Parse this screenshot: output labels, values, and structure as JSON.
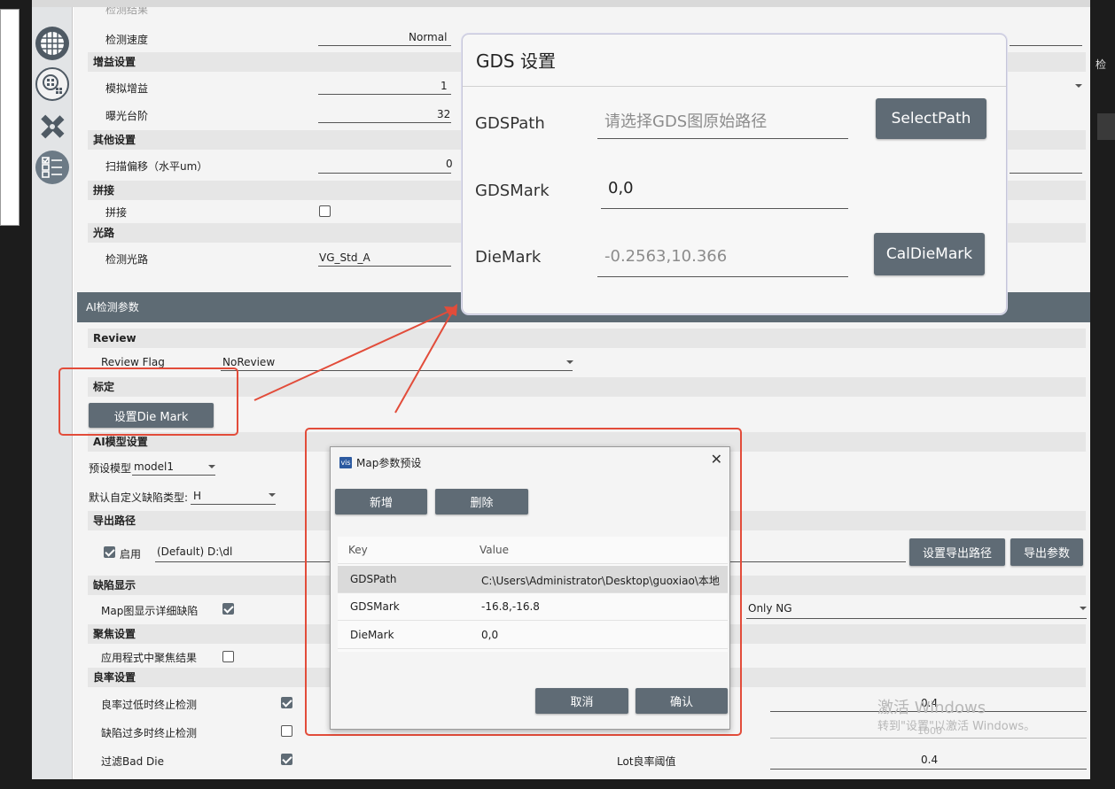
{
  "frame": {
    "right_char": "检"
  },
  "sidebar": {
    "icons": [
      "grid-icon",
      "map-grid-icon",
      "tools-icon",
      "checklist-icon"
    ]
  },
  "upper": {
    "partial_top_label": "检测结果",
    "speed_label": "检测速度",
    "speed_value": "Normal",
    "gain_section": "增益设置",
    "analog_gain_label": "模拟增益",
    "analog_gain_value": "1",
    "exposure_label": "曝光台阶",
    "exposure_value": "32",
    "other_section": "其他设置",
    "scan_offset_label": "扫描偏移（水平um）",
    "scan_offset_value": "0",
    "stitch_section": "拼接",
    "stitch_label": "拼接",
    "optics_section": "光路",
    "optics_label": "检测光路",
    "optics_value": "VG_Std_A"
  },
  "ai": {
    "header": "AI检测参数",
    "review_section": "Review",
    "review_flag_label": "Review Flag",
    "review_flag_value": "NoReview",
    "calib_section": "标定",
    "set_die_mark_button": "设置Die Mark",
    "model_section": "AI模型设置",
    "preset_model_label": "预设模型",
    "preset_model_value": "model1",
    "defect_type_label": "默认自定义缺陷类型:",
    "defect_type_value": "H",
    "export_section": "导出路径",
    "enable_label": "启用",
    "export_path_value": "(Default) D:\\dl",
    "set_export_path_button": "设置导出路径",
    "export_params_button": "导出参数",
    "defect_display_section": "缺陷显示",
    "map_detail_label": "Map图显示详细缺陷",
    "only_ng_value": "Only NG",
    "focus_section": "聚焦设置",
    "apply_focus_label": "应用程式中聚焦结果",
    "yield_section": "良率设置",
    "yield_low_stop_label": "良率过低时终止检测",
    "defect_many_stop_label": "缺陷过多时终止检测",
    "filter_bad_die_label": "过滤Bad Die",
    "lot_yield_label": "Lot良率阈值",
    "lot_yield_value": "0.4",
    "wafer_threshold_value": "0.4",
    "defect_count_value": "1000"
  },
  "gds_panel": {
    "title": "GDS 设置",
    "path_label": "GDSPath",
    "path_placeholder": "请选择GDS图原始路径",
    "select_path_button": "SelectPath",
    "mark_label": "GDSMark",
    "mark_value": "0,0",
    "die_mark_label": "DieMark",
    "die_mark_placeholder": "-0.2563,10.366",
    "cal_die_mark_button": "CalDieMark"
  },
  "map_dialog": {
    "icon_text": "vis",
    "title": "Map参数预设",
    "close_glyph": "✕",
    "add_button": "新增",
    "delete_button": "删除",
    "columns": [
      "Key",
      "Value"
    ],
    "rows": [
      {
        "key": "GDSPath",
        "value": "C:\\Users\\Administrator\\Desktop\\guoxiao\\本地"
      },
      {
        "key": "GDSMark",
        "value": "-16.8,-16.8"
      },
      {
        "key": "DieMark",
        "value": "0,0"
      }
    ],
    "cancel_button": "取消",
    "confirm_button": "确认"
  },
  "watermark": {
    "line1": "激活 Windows",
    "line2": "转到\"设置\"以激活 Windows。"
  },
  "colors": {
    "accent": "#5f6b75",
    "header": "#5e6b74",
    "annotation_red": "#e24c3a"
  }
}
